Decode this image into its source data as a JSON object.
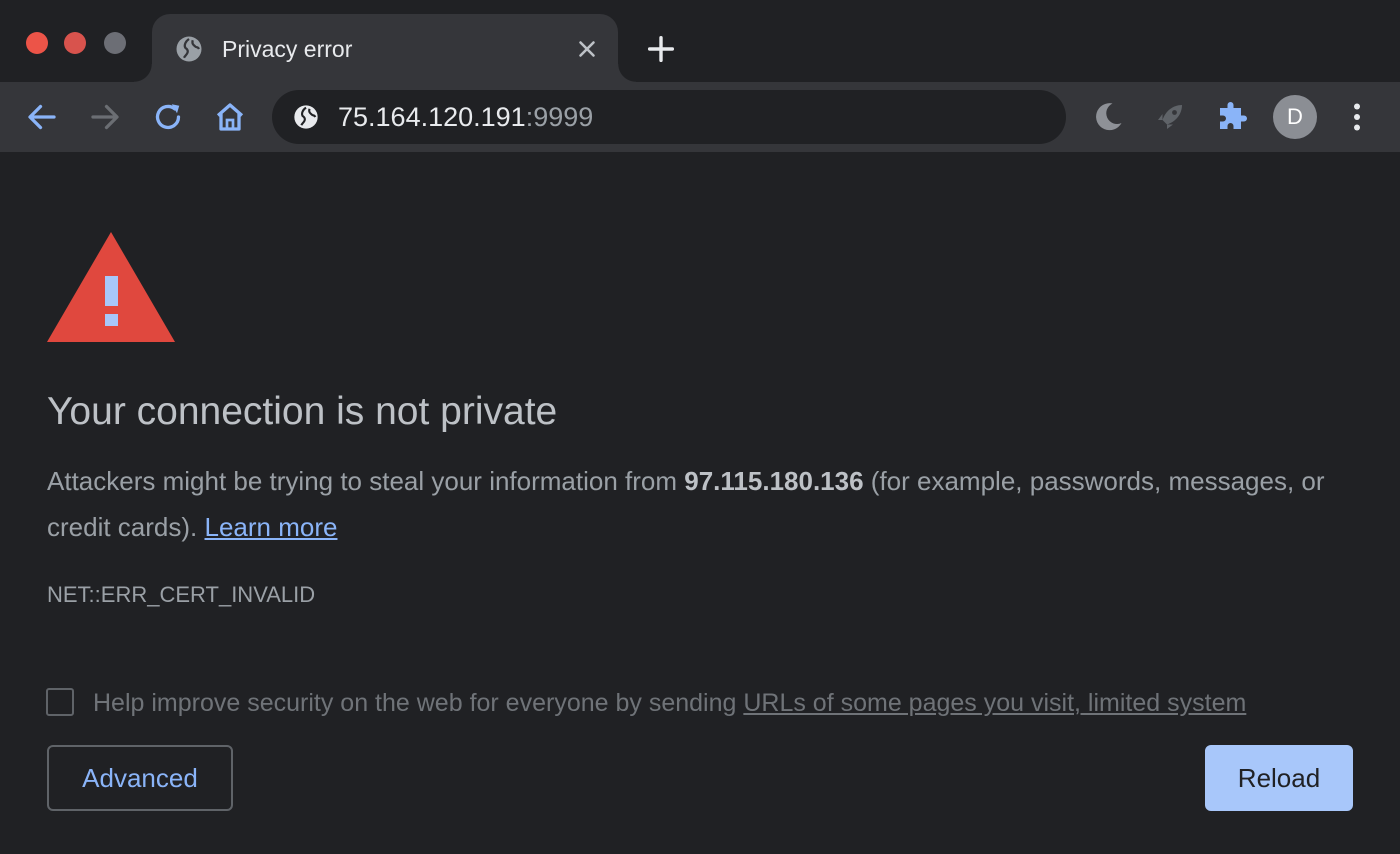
{
  "window": {
    "controls": [
      "close",
      "minimize",
      "maximize"
    ]
  },
  "tab": {
    "title": "Privacy error",
    "favicon": "globe-icon",
    "close_icon": "close-icon"
  },
  "toolbar": {
    "back_icon": "arrow-left-icon",
    "forward_icon": "arrow-right-icon",
    "reload_icon": "reload-icon",
    "home_icon": "home-icon",
    "extensions": [
      "moon-icon",
      "rocket-icon",
      "puzzle-icon"
    ],
    "profile_initial": "D",
    "menu_icon": "kebab-menu-icon"
  },
  "address_bar": {
    "site_icon": "globe-icon",
    "host": "75.164.120.191",
    "port": ":9999"
  },
  "interstitial": {
    "heading": "Your connection is not private",
    "body_before": "Attackers might be trying to steal your information from ",
    "host": "97.115.180.136",
    "body_after": " (for example, passwords, messages, or credit cards). ",
    "learn_more": "Learn more",
    "error_code": "NET::ERR_CERT_INVALID",
    "optin_text": "Help improve security on the web for everyone by sending ",
    "optin_link": "URLs of some pages you visit, limited system",
    "optin_checked": false,
    "advanced_label": "Advanced",
    "reload_label": "Reload"
  },
  "colors": {
    "background": "#202124",
    "toolbar": "#35363a",
    "warning_red": "#e0483e",
    "link_blue": "#8ab4f8",
    "primary_button": "#a8c7fa"
  }
}
